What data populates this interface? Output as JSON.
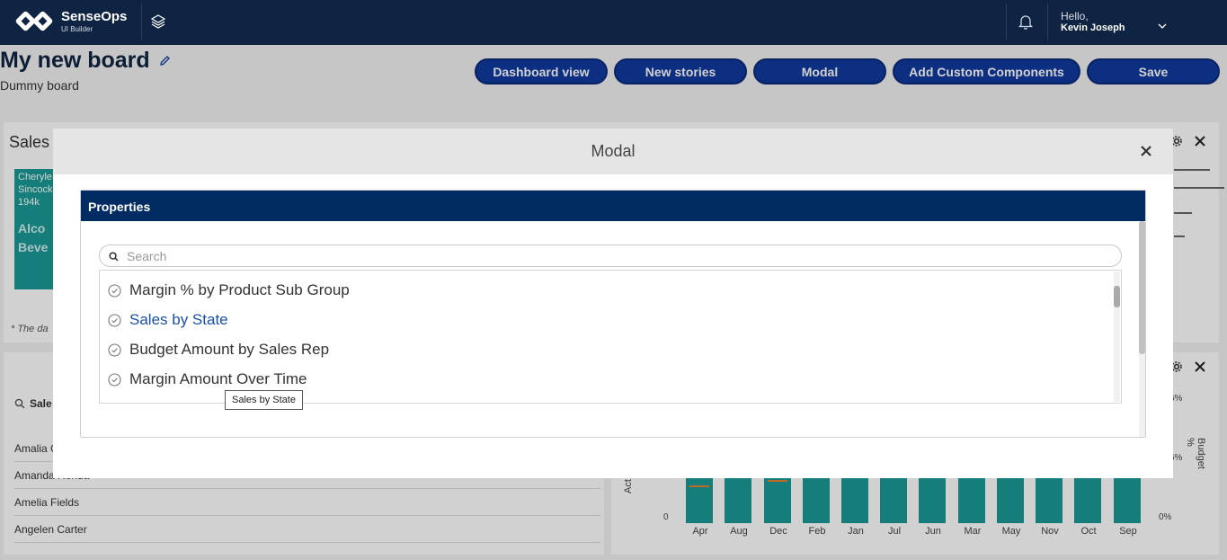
{
  "nav": {
    "brand": "SenseOps",
    "brand_sub": "UI Builder",
    "greeting": "Hello,",
    "user_name": "Kevin Joseph"
  },
  "page": {
    "title": "My new board",
    "subtitle": "Dummy board"
  },
  "actions": [
    "Dashboard view",
    "New stories",
    "Modal",
    "Add Custom Components",
    "Save"
  ],
  "background": {
    "sales_title": "Sales",
    "treemap_lines": [
      "Cheryle",
      "Sincock",
      "194k"
    ],
    "treemap_big": [
      "Alco",
      "Beve"
    ],
    "note": "* The da",
    "list_search_label": "Sale",
    "list_rows": [
      "Amalia C",
      "Amanda Honda",
      "Amelia Fields",
      "Angelen Carter"
    ],
    "months": [
      "Apr",
      "Aug",
      "Dec",
      "Feb",
      "Jan",
      "Jul",
      "Jun",
      "Mar",
      "May",
      "Nov",
      "Oct",
      "Sep"
    ],
    "y_zero": "0",
    "y_left_label": "Act",
    "y_right_label": "Budget %",
    "y_right_ticks": [
      "6%",
      "6%",
      "0%"
    ]
  },
  "modal": {
    "title": "Modal",
    "section_title": "Properties",
    "search_placeholder": "Search",
    "items": [
      {
        "label": "Margin % by Product Sub Group",
        "active": false
      },
      {
        "label": "Sales by State",
        "active": true
      },
      {
        "label": "Budget Amount by Sales Rep",
        "active": false
      },
      {
        "label": "Margin Amount Over Time",
        "active": false
      }
    ],
    "tooltip": "Sales by State"
  },
  "colors": {
    "nav_bg": "#0f2443",
    "button_bg": "#0f3a9e",
    "section_header": "#002b63",
    "active_item": "#1a4fa8",
    "bar": "#1a9a95"
  },
  "icons": [
    "layers-icon",
    "bell-icon",
    "chevron-down-icon",
    "pencil-icon",
    "gear-icon",
    "close-icon",
    "search-icon",
    "check-circle-icon"
  ]
}
